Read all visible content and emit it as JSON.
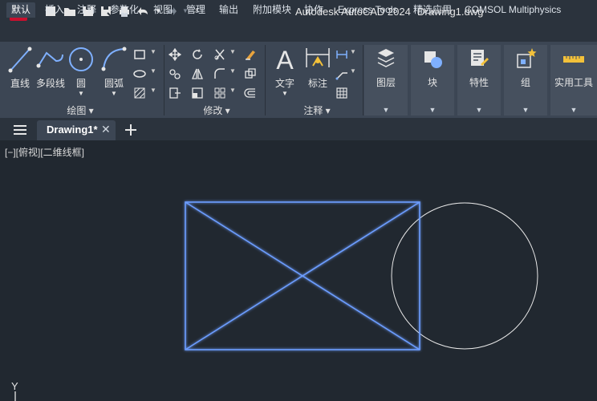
{
  "app": {
    "logo_letter": "A",
    "title": "Autodesk AutoCAD 2024",
    "document": "Drawing1.dwg"
  },
  "ribbon_tabs": [
    "默认",
    "插入",
    "注释",
    "参数化",
    "视图",
    "管理",
    "输出",
    "附加模块",
    "协作",
    "Express Tools",
    "精选应用",
    "COMSOL Multiphysics"
  ],
  "draw_panel": {
    "title": "绘图",
    "tools": [
      "直线",
      "多段线",
      "圆",
      "圆弧"
    ]
  },
  "modify_panel": {
    "title": "修改"
  },
  "annotation_panel": {
    "title": "注释",
    "tools": [
      "文字",
      "标注"
    ]
  },
  "groups": [
    "图层",
    "块",
    "特性",
    "组",
    "实用工具"
  ],
  "document_tab": {
    "label": "Drawing1*"
  },
  "viewport_label": "[−][俯视][二维线框]",
  "ucs_axis": "Y",
  "colors": {
    "accent_red": "#c8102e",
    "selection_blue": "#5b8cff",
    "canvas_bg": "#212830"
  }
}
